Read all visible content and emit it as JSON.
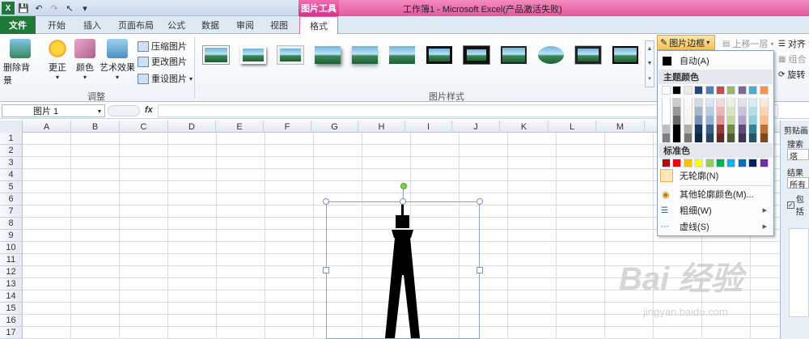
{
  "window": {
    "title": "工作簿1 - Microsoft Excel(产品激活失败)",
    "context_tool": "图片工具"
  },
  "tabs": [
    {
      "label": "文件"
    },
    {
      "label": "开始"
    },
    {
      "label": "插入"
    },
    {
      "label": "页面布局"
    },
    {
      "label": "公式"
    },
    {
      "label": "数据"
    },
    {
      "label": "审阅"
    },
    {
      "label": "视图"
    },
    {
      "label": "格式"
    }
  ],
  "ribbon": {
    "adjust": {
      "remove_bg": "删除背景",
      "correct": "更正",
      "color": "颜色",
      "art": "艺术效果",
      "compress": "压缩图片",
      "change": "更改图片",
      "reset": "重设图片",
      "group_label": "调整"
    },
    "styles": {
      "group_label": "图片样式"
    },
    "arrange": {
      "border": "图片边框",
      "bring_forward": "上移一层",
      "align": "对齐",
      "group": "组合",
      "rotate": "旋转"
    }
  },
  "formula": {
    "name_box": "图片 1",
    "fx": "fx"
  },
  "columns": [
    "A",
    "B",
    "C",
    "D",
    "E",
    "F",
    "G",
    "H",
    "I",
    "J",
    "K",
    "L",
    "M"
  ],
  "rows": [
    "1",
    "2",
    "3",
    "4",
    "5",
    "6",
    "7",
    "8",
    "9",
    "10",
    "11",
    "12",
    "13",
    "14",
    "15",
    "16",
    "17"
  ],
  "dropdown": {
    "auto": "自动(A)",
    "theme_header": "主题颜色",
    "standard_header": "标准色",
    "no_outline": "无轮廓(N)",
    "more_colors": "其他轮廓颜色(M)...",
    "weight": "粗细(W)",
    "dashes": "虚线(S)",
    "theme_top": [
      "#ffffff",
      "#000000",
      "#eeece1",
      "#1f497d",
      "#4f81bd",
      "#c0504d",
      "#9bbb59",
      "#8064a2",
      "#4bacc6",
      "#f79646"
    ],
    "standard": [
      "#c00000",
      "#ff0000",
      "#ffc000",
      "#ffff00",
      "#92d050",
      "#00b050",
      "#00b0f0",
      "#0070c0",
      "#002060",
      "#7030a0"
    ]
  },
  "sidepane": {
    "title": "剪贴画",
    "search": "搜索文",
    "search_value": "塔",
    "results": "结果类",
    "results_value": "所有",
    "include": "包括"
  },
  "watermark": {
    "logo": "Bai 经验",
    "url": "jingyan.baidu.com"
  }
}
